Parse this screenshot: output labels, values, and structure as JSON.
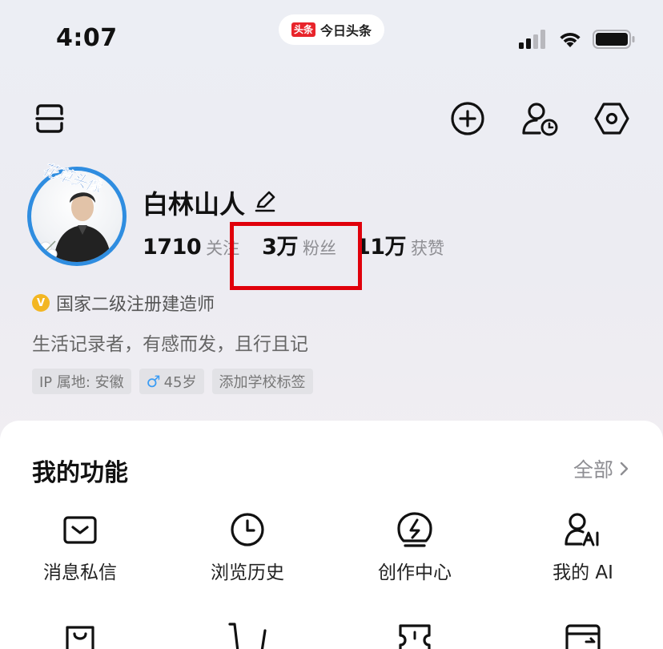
{
  "status_bar": {
    "time": "4:07",
    "app_badge": "头条",
    "app_name": "今日头条"
  },
  "profile": {
    "avatar_overlay_text": "花草头像",
    "name": "白林山人",
    "stats": [
      {
        "value": "1710",
        "label": "关注"
      },
      {
        "value": "3万",
        "label": "粉丝"
      },
      {
        "value": "11万",
        "label": "获赞"
      }
    ],
    "cert_badge": "V",
    "certification": "国家二级注册建造师",
    "bio": "生活记录者，有感而发，且行且记",
    "tags": {
      "ip": "IP 属地: 安徽",
      "age_icon": "♂",
      "age": "45岁",
      "school": "添加学校标签"
    }
  },
  "features": {
    "title": "我的功能",
    "all_label": "全部",
    "items": [
      {
        "label": "消息私信",
        "icon": "message-icon"
      },
      {
        "label": "浏览历史",
        "icon": "history-icon"
      },
      {
        "label": "创作中心",
        "icon": "creator-icon"
      },
      {
        "label": "我的 AI",
        "icon": "ai-icon"
      }
    ],
    "row2_icons": [
      "bag-icon",
      "cart-icon",
      "ticket-icon",
      "wallet-icon"
    ]
  },
  "colors": {
    "highlight": "#e0000b",
    "brand_red": "#e8242b",
    "avatar_ring": "#2f8de0",
    "cert_gold": "#f3b623"
  }
}
